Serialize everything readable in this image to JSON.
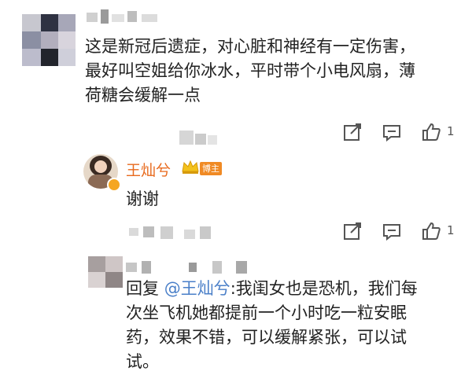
{
  "comments": [
    {
      "user_name": "",
      "text_lines": [
        "这是新冠后遗症，对心脏和神经有一定伤害，",
        "最好叫空姐给你冰水，平时带个小电风扇，薄",
        "荷糖会缓解一点"
      ],
      "like_count": "1",
      "icons": [
        "share-icon",
        "comment-icon",
        "like-icon"
      ]
    }
  ],
  "reply_author": {
    "name": "王灿兮",
    "badge": "博主",
    "text": "谢谢"
  },
  "second_actions": {
    "like_count": "1"
  },
  "reply2": {
    "text_lines": [
      "回复 @王灿兮:我闺女也是恐机，我们每",
      "次坐飞机她都提前一个小时吃一粒安眠",
      "药，效果不错，可以缓解紧张，可以试",
      "试。"
    ],
    "mention": "@王灿兮"
  },
  "colors": {
    "accent": "#e86a1d",
    "link": "#4a7fc8",
    "badge": "#f08a24"
  }
}
